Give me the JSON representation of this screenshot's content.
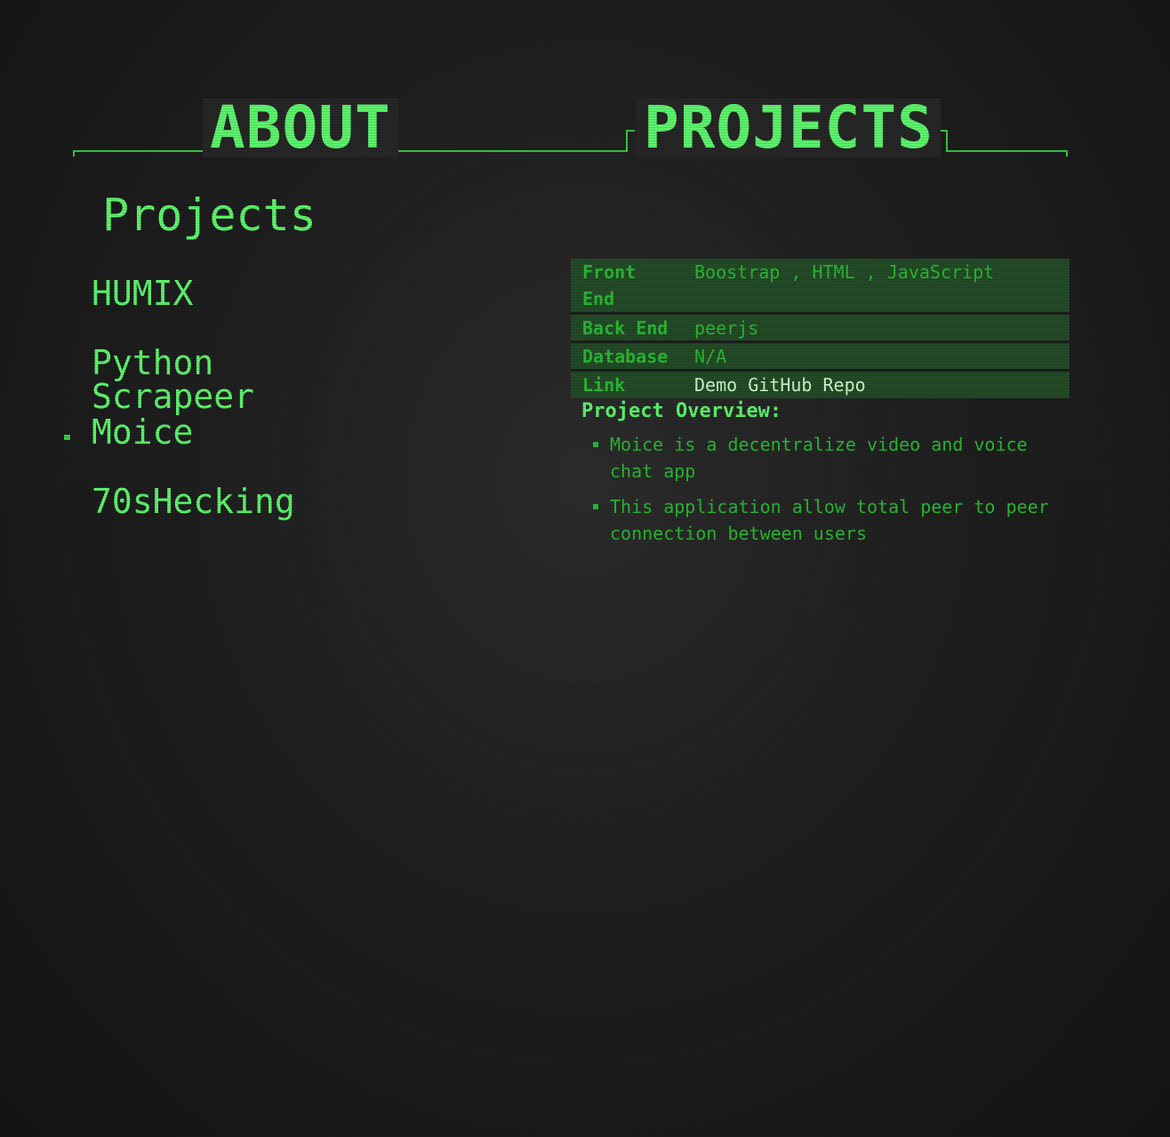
{
  "tabs": {
    "about": "ABOUT",
    "projects": "PROJECTS"
  },
  "section_title": "Projects",
  "projects": [
    "HUMIX",
    "Python Scrapeer",
    "Moice",
    "70sHecking"
  ],
  "selected_project": "Moice",
  "details": {
    "rows": [
      {
        "key": "Front End",
        "value": "Boostrap , HTML , JavaScript"
      },
      {
        "key": "Back End",
        "value": "peerjs"
      },
      {
        "key": "Database",
        "value": "N/A"
      },
      {
        "key": "Link",
        "demo": "Demo",
        "repo": "GitHub Repo"
      }
    ]
  },
  "overview": {
    "title": "Project Overview:",
    "items": [
      "Moice is a decentralize video and voice chat app",
      "This application allow total peer to peer connection between users"
    ]
  },
  "colors": {
    "accent": "#5cf36c",
    "accent_dim": "#27b832",
    "line": "#35c93f",
    "table_bg": "#234a26",
    "background": "#1e1e1e"
  }
}
